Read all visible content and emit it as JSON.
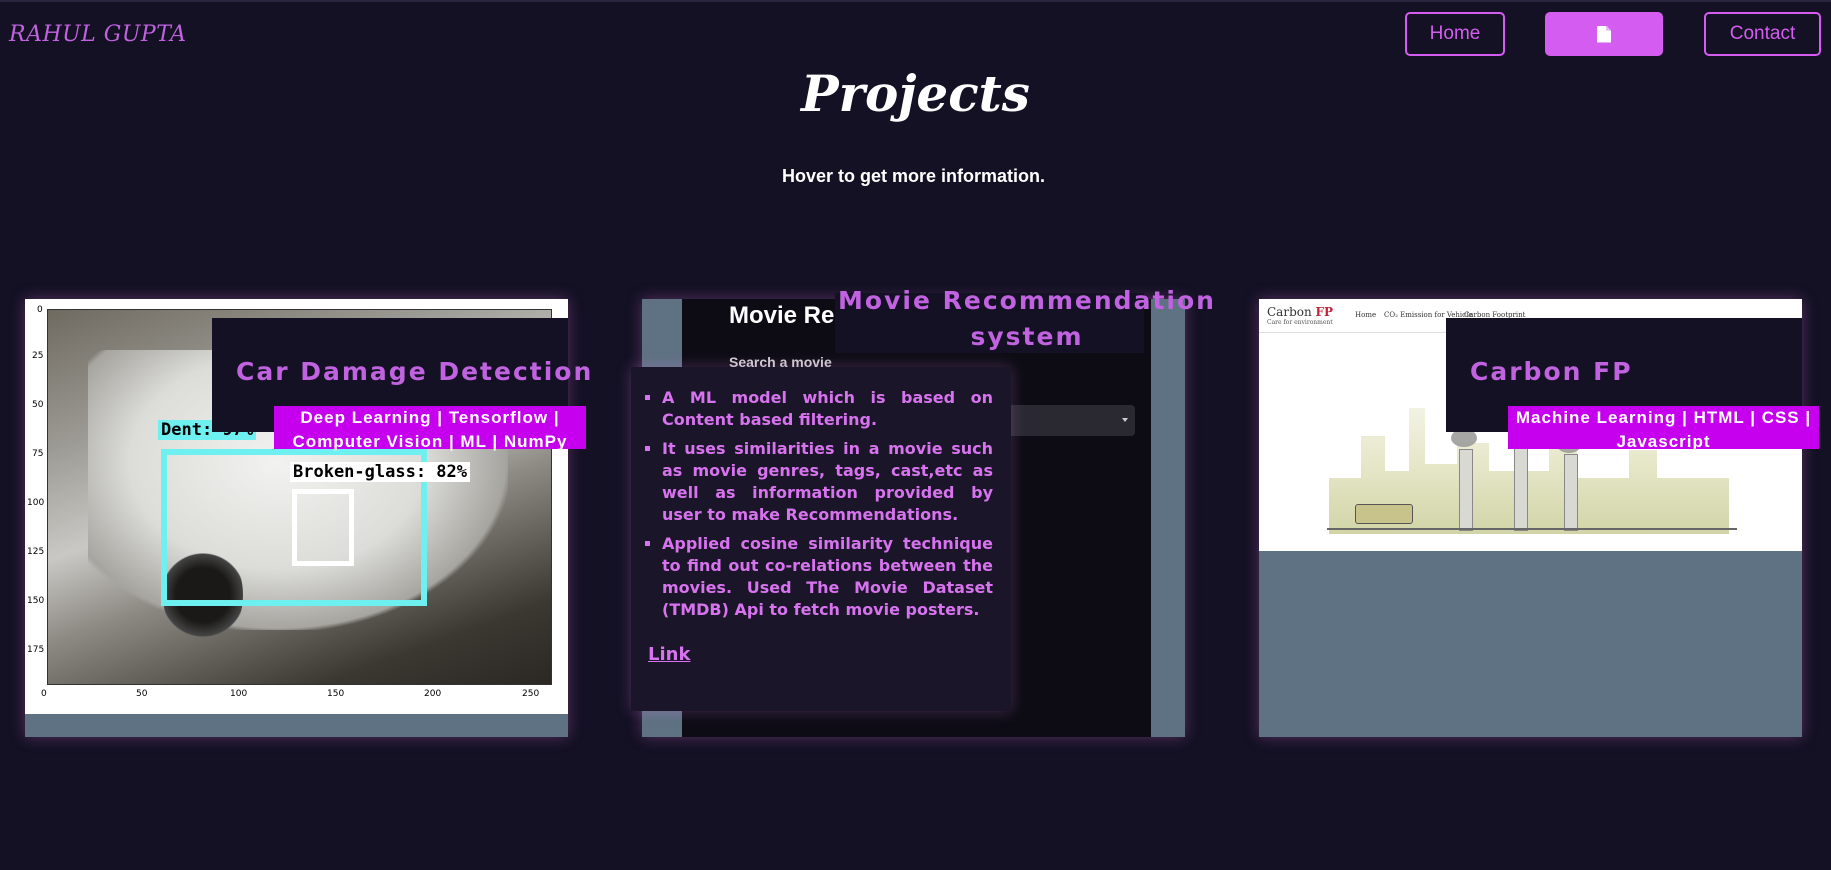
{
  "header": {
    "brand": "RAHUL GUPTA",
    "nav": {
      "home": "Home",
      "resume_icon": "document-icon",
      "contact": "Contact"
    }
  },
  "page": {
    "title": "Projects",
    "subtitle": "Hover to get more information."
  },
  "projects": [
    {
      "title": "Car Damage Detection",
      "tags": "Deep Learning | Tensorflow | Computer Vision | ML | NumPy",
      "image": {
        "detections": [
          {
            "label": "Dent: 97%"
          },
          {
            "label": "Broken-glass: 82%"
          }
        ],
        "x_ticks": [
          "0",
          "50",
          "100",
          "150",
          "200",
          "250"
        ],
        "y_ticks": [
          "0",
          "25",
          "50",
          "75",
          "100",
          "125",
          "150",
          "175"
        ]
      }
    },
    {
      "title": "Movie Recommendation system",
      "screenshot_heading": "Movie Recom",
      "screenshot_subheading": "Search a movie",
      "bullets": [
        "A ML model which is based on Content based filtering.",
        "It uses similarities in a movie such as movie genres, tags, cast,etc as well as information provided by user to make Recommendations.",
        "Applied cosine similarity technique to find out co-relations between the movies. Used The Movie Dataset (TMDB) Api to fetch movie posters."
      ],
      "link": "Link"
    },
    {
      "title": "Carbon FP",
      "tags": "Machine Learning | HTML | CSS | Javascript",
      "site": {
        "logo_main": "Carbon ",
        "logo_accent": "FP",
        "logo_tagline": "Care for environment",
        "nav": [
          "Home",
          "CO₂ Emission for Vehicle",
          "Carbon Footprint"
        ]
      }
    }
  ],
  "colors": {
    "background": "#141124",
    "accent": "#d45cf0",
    "title_purple": "#c163e0",
    "tag_bg": "#c600ef",
    "card_bg": "#5e7283"
  }
}
